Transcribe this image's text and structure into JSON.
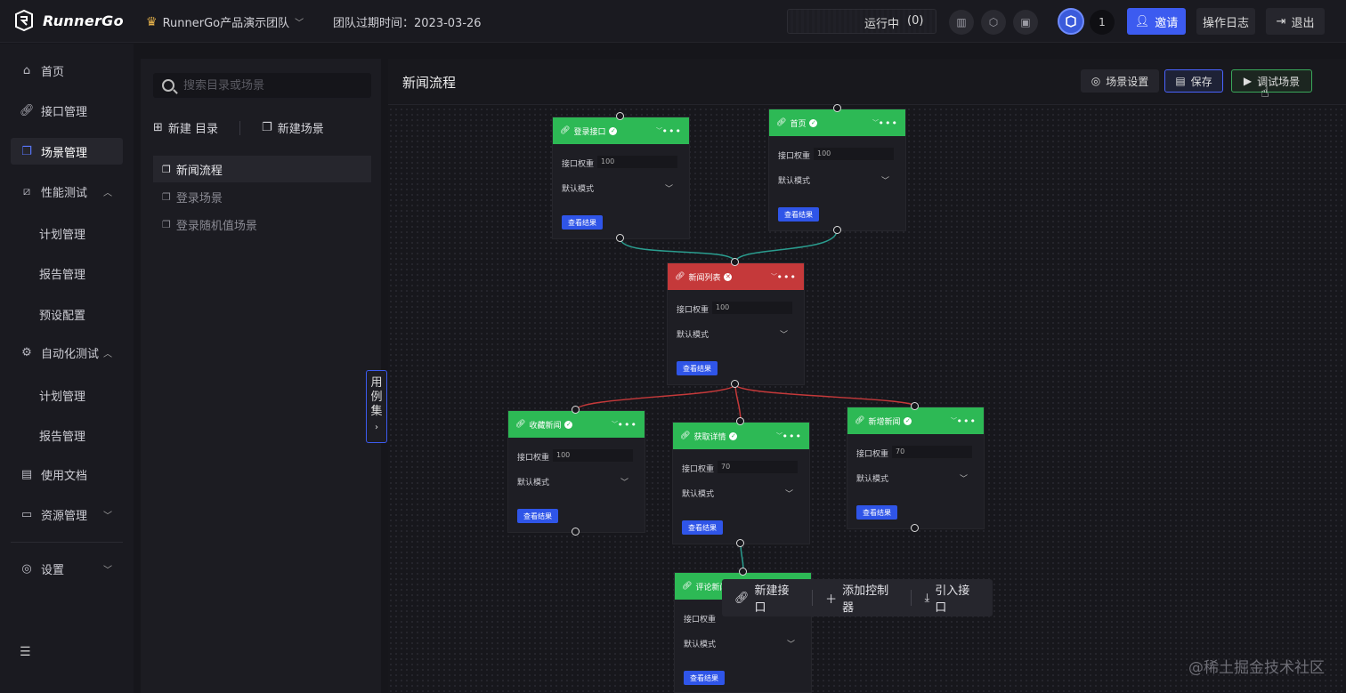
{
  "brand": {
    "name": "RunnerGo",
    "logo_icon": "runnergo-logo-icon"
  },
  "header": {
    "team_name": "RunnerGo产品演示团队",
    "team_expire": "团队过期时间：2023-03-26",
    "running_label": "运行中",
    "running_count": "(0)",
    "avatar_count": "1",
    "invite_label": "邀请",
    "log_label": "操作日志",
    "logout_label": "退出",
    "accent": "#3c5bf0"
  },
  "sidebar": {
    "items": [
      {
        "label": "首页",
        "icon": "home-icon"
      },
      {
        "label": "接口管理",
        "icon": "link-icon"
      },
      {
        "label": "场景管理",
        "icon": "scene-icon"
      },
      {
        "label": "性能测试",
        "icon": "chart-icon"
      },
      {
        "label": "计划管理"
      },
      {
        "label": "报告管理"
      },
      {
        "label": "预设配置"
      },
      {
        "label": "自动化测试",
        "icon": "auto-icon"
      },
      {
        "label": "计划管理"
      },
      {
        "label": "报告管理"
      },
      {
        "label": "使用文档",
        "icon": "doc-icon"
      },
      {
        "label": "资源管理",
        "icon": "monitor-icon"
      },
      {
        "label": "设置",
        "icon": "settings-icon"
      }
    ]
  },
  "tree": {
    "search_placeholder": "搜索目录或场景",
    "new_folder": "新建 目录",
    "new_scene": "新建场景",
    "scenes": [
      "新闻流程",
      "登录场景",
      "登录随机值场景"
    ]
  },
  "canvas": {
    "title": "新闻流程",
    "scene_settings": "场景设置",
    "save": "保存",
    "debug": "调试场景",
    "side_tab": [
      "用",
      "例",
      "集"
    ],
    "nodes": [
      {
        "name": "登录接口",
        "weight_label": "接口权重",
        "weight": "100",
        "mode": "默认模式",
        "view": "查看结果",
        "status": "success"
      },
      {
        "name": "首页",
        "weight_label": "接口权重",
        "weight": "100",
        "mode": "默认模式",
        "view": "查看结果",
        "status": "success"
      },
      {
        "name": "新闻列表",
        "weight_label": "接口权重",
        "weight": "100",
        "mode": "默认模式",
        "view": "查看结果",
        "status": "error"
      },
      {
        "name": "收藏新闻",
        "weight_label": "接口权重",
        "weight": "100",
        "mode": "默认模式",
        "view": "查看结果",
        "status": "success"
      },
      {
        "name": "获取详情",
        "weight_label": "接口权重",
        "weight": "70",
        "mode": "默认模式",
        "view": "查看结果",
        "status": "success"
      },
      {
        "name": "新增新闻",
        "weight_label": "接口权重",
        "weight": "70",
        "mode": "默认模式",
        "view": "查看结果",
        "status": "success"
      },
      {
        "name": "评论新闻",
        "weight_label": "接口权重",
        "weight": "100",
        "mode": "默认模式",
        "view": "查看结果",
        "status": "success"
      }
    ],
    "toolbar": {
      "new_api": "新建接口",
      "add_controller": "添加控制器",
      "import_api": "引入接口"
    }
  },
  "watermark": "@稀土掘金技术社区",
  "colors": {
    "success": "#2db955",
    "error": "#c5393a",
    "edge_ok": "#2a9d8f",
    "edge_err": "#c5393a"
  }
}
